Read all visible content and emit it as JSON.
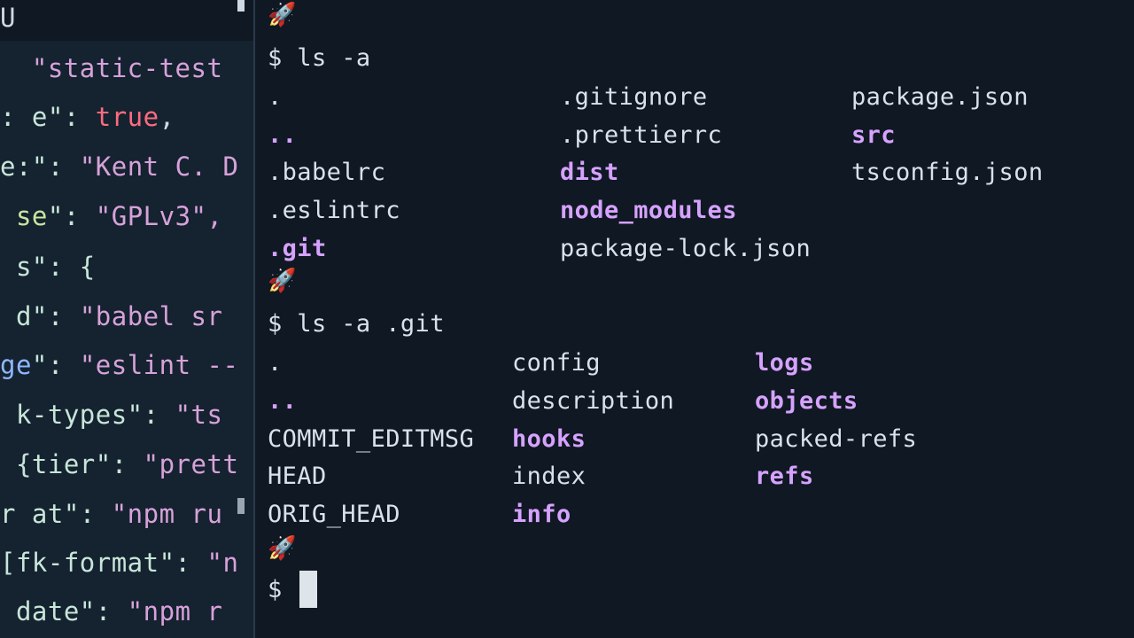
{
  "editor": {
    "lines": [
      {
        "parts": [
          {
            "t": "U",
            "c": "c-white"
          }
        ]
      },
      {
        "parts": [
          {
            "t": "  \"static-test",
            "c": "c-str"
          }
        ]
      },
      {
        "parts": [
          {
            "t": ": e\": ",
            "c": "c-key"
          },
          {
            "t": "true",
            "c": "c-red"
          },
          {
            "t": ",",
            "c": "c-white"
          }
        ]
      },
      {
        "parts": [
          {
            "t": "e:\": ",
            "c": "c-key"
          },
          {
            "t": "\"Kent C. D",
            "c": "c-str"
          }
        ]
      },
      {
        "parts": [
          {
            "t": " se",
            "c": "c-green"
          },
          {
            "t": "\": ",
            "c": "c-key"
          },
          {
            "t": "\"GPLv3\",",
            "c": "c-str"
          }
        ]
      },
      {
        "parts": [
          {
            "t": " s\": {",
            "c": "c-key"
          }
        ]
      },
      {
        "parts": [
          {
            "t": " d\": ",
            "c": "c-key"
          },
          {
            "t": "\"babel sr",
            "c": "c-str"
          }
        ]
      },
      {
        "parts": [
          {
            "t": "ge",
            "c": "c-blue"
          },
          {
            "t": "\": ",
            "c": "c-key"
          },
          {
            "t": "\"eslint --",
            "c": "c-str"
          }
        ]
      },
      {
        "parts": [
          {
            "t": " k-types\": ",
            "c": "c-key"
          },
          {
            "t": "\"ts",
            "c": "c-str"
          }
        ]
      },
      {
        "parts": [
          {
            "t": " {tier\": ",
            "c": "c-key"
          },
          {
            "t": "\"prett",
            "c": "c-str"
          }
        ]
      },
      {
        "parts": [
          {
            "t": "r at\": ",
            "c": "c-key"
          },
          {
            "t": "\"npm ru",
            "c": "c-str"
          }
        ]
      },
      {
        "parts": [
          {
            "t": "[fk-format\": ",
            "c": "c-key"
          },
          {
            "t": "\"n",
            "c": "c-str"
          }
        ]
      },
      {
        "parts": [
          {
            "t": " date\": ",
            "c": "c-key"
          },
          {
            "t": "\"npm r",
            "c": "c-str"
          }
        ]
      }
    ]
  },
  "terminal": {
    "prompt_symbol": "🚀",
    "cmd1": "$ ls -a",
    "ls1": [
      {
        "text": ".",
        "dir": false
      },
      {
        "text": "..",
        "dir": true
      },
      {
        "text": ".babelrc",
        "dir": false
      },
      {
        "text": ".eslintrc",
        "dir": false
      },
      {
        "text": ".git",
        "dir": true
      },
      {
        "text": ".gitignore",
        "dir": false
      },
      {
        "text": ".prettierrc",
        "dir": false
      },
      {
        "text": "dist",
        "dir": true
      },
      {
        "text": "node_modules",
        "dir": true
      },
      {
        "text": "package-lock.json",
        "dir": false
      },
      {
        "text": "package.json",
        "dir": false
      },
      {
        "text": "src",
        "dir": true
      },
      {
        "text": "tsconfig.json",
        "dir": false
      }
    ],
    "cmd2": "$ ls -a .git",
    "ls2": [
      {
        "text": ".",
        "dir": false
      },
      {
        "text": "..",
        "dir": true
      },
      {
        "text": "COMMIT_EDITMSG",
        "dir": false
      },
      {
        "text": "HEAD",
        "dir": false
      },
      {
        "text": "ORIG_HEAD",
        "dir": false
      },
      {
        "text": "config",
        "dir": false
      },
      {
        "text": "description",
        "dir": false
      },
      {
        "text": "hooks",
        "dir": true
      },
      {
        "text": "index",
        "dir": false
      },
      {
        "text": "info",
        "dir": true
      },
      {
        "text": "logs",
        "dir": true
      },
      {
        "text": "objects",
        "dir": true
      },
      {
        "text": "packed-refs",
        "dir": false
      },
      {
        "text": "refs",
        "dir": true
      }
    ],
    "prompt3": "$"
  }
}
